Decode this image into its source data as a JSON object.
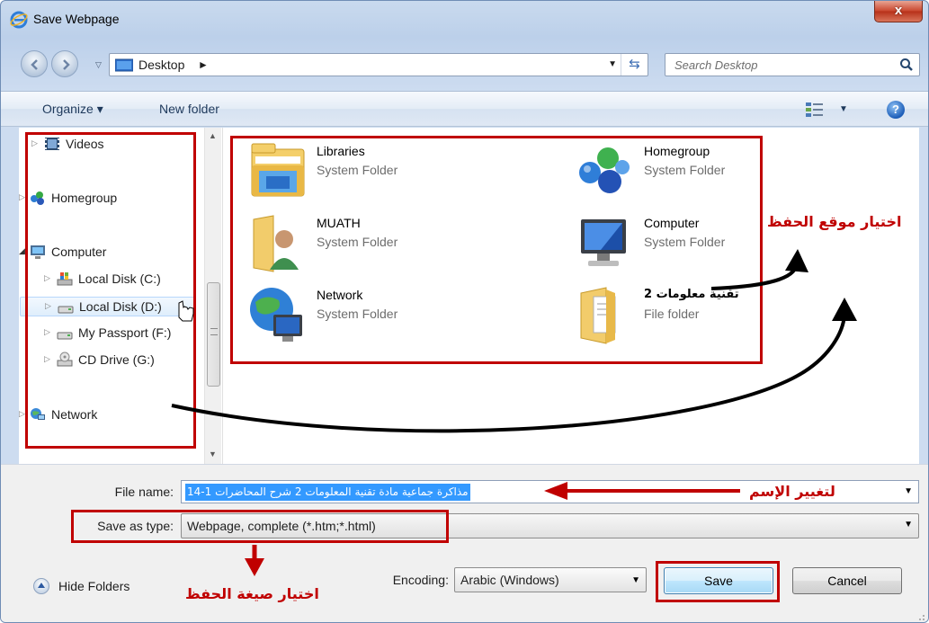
{
  "window": {
    "title": "Save Webpage",
    "close_label": "x"
  },
  "address": {
    "location": "Desktop",
    "separator": "►",
    "search_placeholder": "Search Desktop"
  },
  "toolbar": {
    "organize_label": "Organize ▾",
    "new_folder_label": "New folder",
    "help_label": "?"
  },
  "nav": {
    "videos": "Videos",
    "homegroup": "Homegroup",
    "computer": "Computer",
    "local_c": "Local Disk (C:)",
    "local_d": "Local Disk (D:)",
    "passport": "My Passport (F:)",
    "cd_drive": "CD Drive (G:)",
    "network": "Network"
  },
  "items": [
    {
      "name": "Libraries",
      "type": "System Folder",
      "icon": "libraries-icon"
    },
    {
      "name": "Homegroup",
      "type": "System Folder",
      "icon": "homegroup-icon"
    },
    {
      "name": "MUATH",
      "type": "System Folder",
      "icon": "user-folder-icon"
    },
    {
      "name": "Computer",
      "type": "System Folder",
      "icon": "computer-icon"
    },
    {
      "name": "Network",
      "type": "System Folder",
      "icon": "network-icon"
    },
    {
      "name": "تقنية معلومات 2",
      "type": "File folder",
      "icon": "folder-icon"
    }
  ],
  "form": {
    "filename_label": "File name:",
    "filename_value": "مذاكرة جماعية مادة تقنية المعلومات 2  شرح المحاضرات 1-14",
    "savetype_label": "Save as type:",
    "savetype_value": "Webpage, complete (*.htm;*.html)",
    "hide_folders_label": "Hide Folders",
    "encoding_label": "Encoding:",
    "encoding_value": "Arabic (Windows)",
    "save_label": "Save",
    "cancel_label": "Cancel"
  },
  "annotations": {
    "location_note": "اختيار موقع الحفظ",
    "rename_note": "لتغيير الإسم",
    "format_note": "اختيار صيغة الحفظ"
  },
  "colors": {
    "annotation_red": "#c00000",
    "selection_blue": "#3399ff"
  }
}
